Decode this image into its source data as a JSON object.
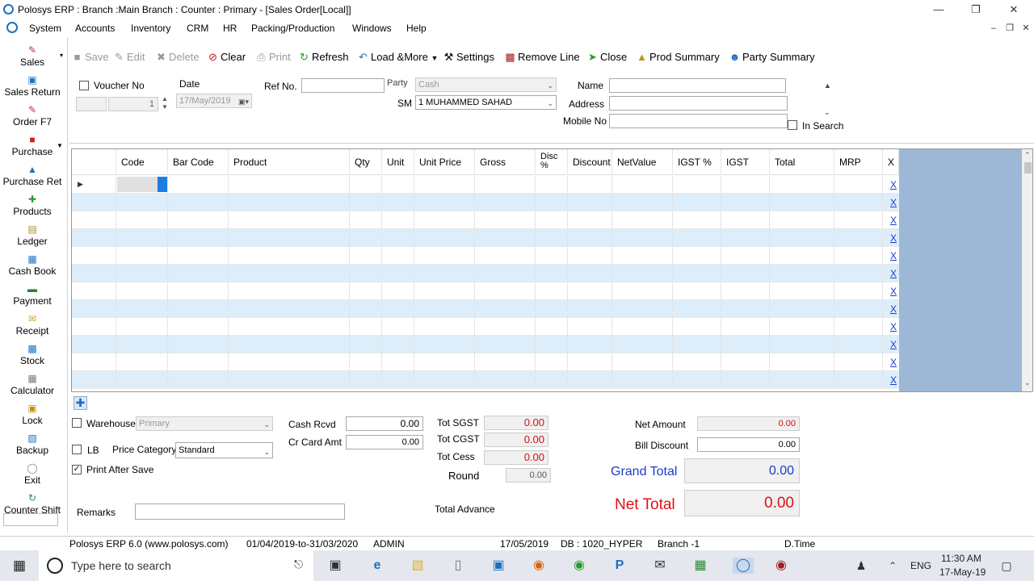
{
  "window": {
    "title": "Polosys ERP  :  Branch :Main Branch : Counter : Primary - [Sales Order[Local]]"
  },
  "menu": [
    "System",
    "Accounts",
    "Inventory",
    "CRM",
    "HR",
    "Packing/Production",
    "Windows",
    "Help"
  ],
  "sidebar": [
    "Sales",
    "Sales Return",
    "Order F7",
    "Purchase",
    "Purchase Ret",
    "Products",
    "Ledger",
    "Cash Book",
    "Payment",
    "Receipt",
    "Stock",
    "Calculator",
    "Lock",
    "Backup",
    "Exit",
    "Counter Shift"
  ],
  "toolbar": {
    "save": "Save",
    "edit": "Edit",
    "delete": "Delete",
    "clear": "Clear",
    "print": "Print",
    "refresh": "Refresh",
    "load": "Load &More",
    "settings": "Settings",
    "remove": "Remove Line",
    "close": "Close",
    "prod": "Prod Summary",
    "party": "Party Summary"
  },
  "header": {
    "voucher_label": "Voucher No",
    "voucher_value": "1",
    "date_label": "Date",
    "date_value": "17/May/2019",
    "ref_label": "Ref No.",
    "party_label": "Party",
    "party_value": "Cash",
    "sm_label": "SM",
    "sm_value": "1 MUHAMMED SAHAD",
    "name_label": "Name",
    "address_label": "Address",
    "mobile_label": "Mobile No",
    "insearch_label": "In Search"
  },
  "grid": {
    "columns": [
      "Code",
      "Bar Code",
      "Product",
      "Qty",
      "Unit",
      "Unit Price",
      "Gross",
      "Disc %",
      "Discount",
      "NetValue",
      "IGST %",
      "IGST",
      "Total",
      "MRP",
      "X"
    ],
    "row_remove": "X"
  },
  "footer": {
    "warehouse_label": "Warehouse",
    "warehouse_value": "Primary",
    "lb_label": "LB",
    "price_cat_label": "Price Category",
    "price_cat_value": "Standard",
    "print_after_label": "Print After Save",
    "remarks_label": "Remarks",
    "cash_rcvd_label": "Cash Rcvd",
    "cash_rcvd_value": "0.00",
    "cr_card_label": "Cr Card Amt",
    "cr_card_value": "0.00",
    "tot_sgst_label": "Tot SGST",
    "tot_sgst_value": "0.00",
    "tot_cgst_label": "Tot CGST",
    "tot_cgst_value": "0.00",
    "tot_cess_label": "Tot Cess",
    "tot_cess_value": "0.00",
    "round_label": "Round",
    "round_value": "0.00",
    "total_adv_label": "Total Advance",
    "net_amount_label": "Net Amount",
    "net_amount_value": "0.00",
    "bill_disc_label": "Bill Discount",
    "bill_disc_value": "0.00",
    "grand_total_label": "Grand Total",
    "grand_total_value": "0.00",
    "net_total_label": "Net Total",
    "net_total_value": "0.00"
  },
  "status": {
    "product": "Polosys ERP 6.0 (www.polosys.com)",
    "period": "01/04/2019-to-31/03/2020",
    "user": "ADMIN",
    "date": "17/05/2019",
    "db": "DB : 1020_HYPER",
    "branch": "Branch -1",
    "time_label": "D.Time"
  },
  "taskbar": {
    "search_placeholder": "Type here to search",
    "lang": "ENG",
    "time": "11:30 AM",
    "date": "17-May-19"
  },
  "colors": {
    "accent": "#1e6fc0",
    "row_alt": "#ddeefa",
    "pane": "#9cb8d6",
    "net_total": "#e0101a",
    "grand_total": "#1a3cc8"
  }
}
